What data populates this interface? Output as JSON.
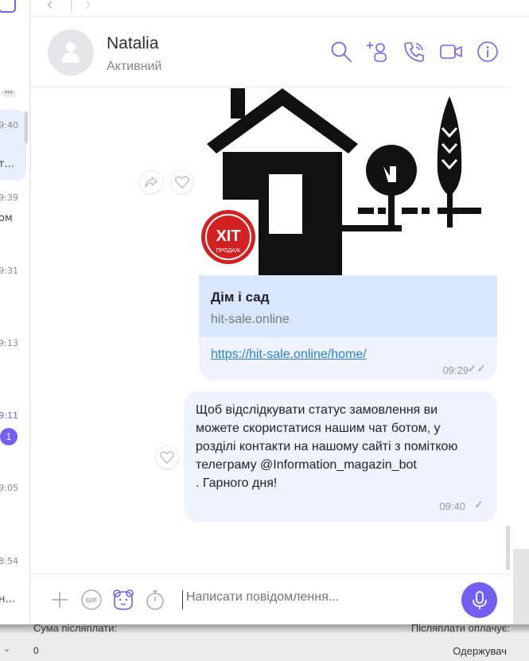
{
  "sidebar": {
    "times": [
      "09:40",
      "09:39",
      "09:31",
      "09:13",
      "09:11",
      "09:05",
      "8:54"
    ],
    "snippets": [
      "т...",
      "ом",
      "н..."
    ],
    "unread_count": "1"
  },
  "header": {
    "name": "Natalia",
    "status": "Активний"
  },
  "link_card": {
    "preview_title": "Дім і сад",
    "preview_site": "hit-sale.online",
    "link": "https://hit-sale.online/home/",
    "time": "09:29",
    "badge_text_main": "ХІТ",
    "badge_text_sub": "ПРОДАЖ"
  },
  "message": {
    "lines": [
      "Щоб відслідкувати статус замовлення ви",
      "можете скористатися нашим чат ботом, у",
      "розділі контакти на нашому сайті з поміткою",
      "телеграму @Information_magazin_bot",
      ". Гарного дня!"
    ],
    "time": "09:40"
  },
  "composer": {
    "placeholder": "Написати повідомлення..."
  },
  "background_window": {
    "left_label": "Сума післяплати:",
    "right_label": "Післяплати оплачує:",
    "left_value": "0",
    "right_value": "Одержувач"
  },
  "colors": {
    "accent": "#7360f2",
    "bubble": "#eef3fd",
    "preview": "#d9e6fb",
    "link": "#2a7de1"
  }
}
